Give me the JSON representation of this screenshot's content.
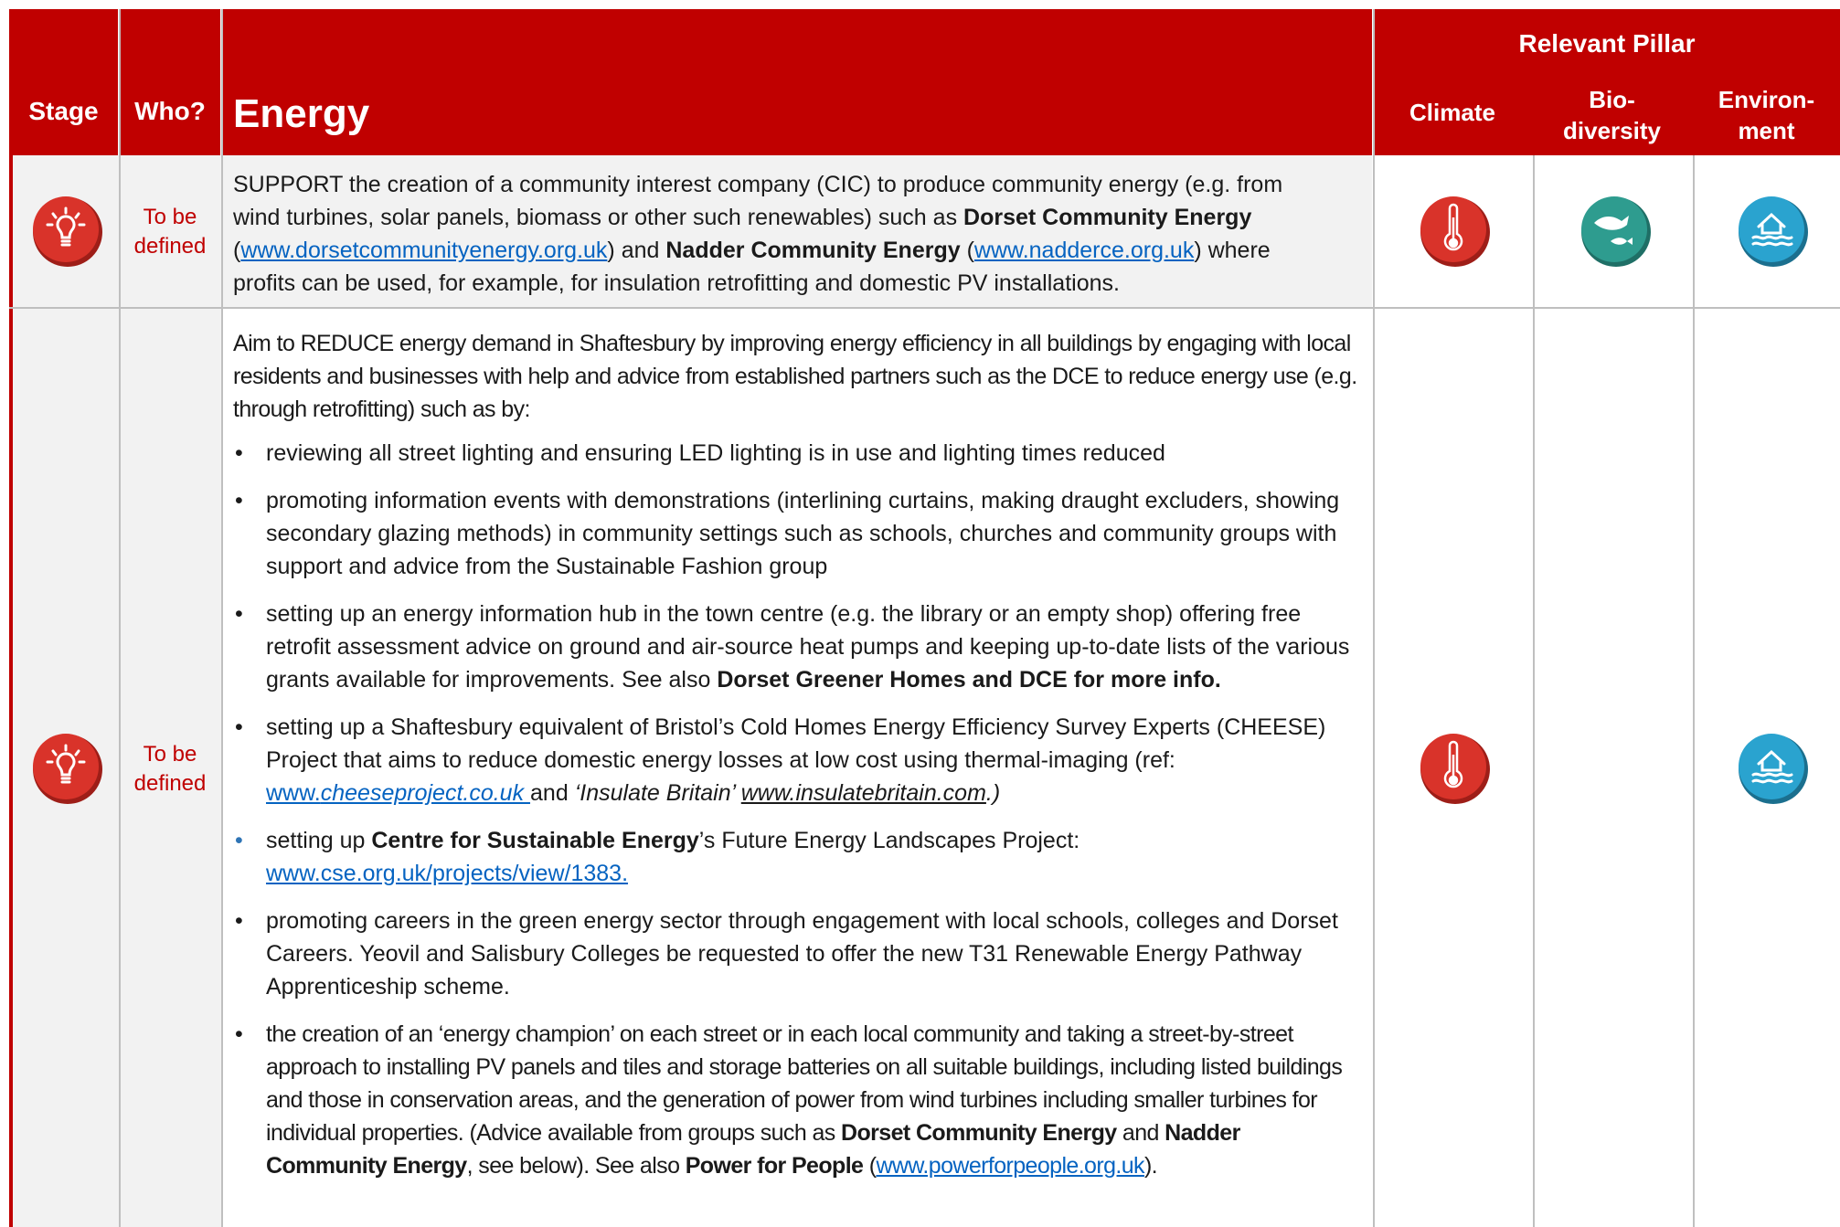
{
  "header": {
    "stage": "Stage",
    "who": "Who?",
    "topic": "Energy",
    "pillar_title": "Relevant Pillar",
    "pillars": {
      "climate": "Climate",
      "bio_l1": "Bio-",
      "bio_l2": "diversity",
      "env_l1": "Environ-",
      "env_l2": "ment"
    }
  },
  "colors": {
    "header_red": "#c00000",
    "climate_red": "#d9332a",
    "bio_teal": "#2e9c8f",
    "env_blue": "#2aa3cf",
    "link_blue": "#0563c1"
  },
  "icons": {
    "stage": "lightbulb-icon",
    "climate": "thermometer-icon",
    "bio": "whale-fish-icon",
    "env": "flooded-house-icon"
  },
  "row1": {
    "who_l1": "To be",
    "who_l2": "defined",
    "t1": "SUPPORT the creation of a community interest company (CIC) to produce community energy (e.g. from",
    "t2a": "wind turbines, solar panels, biomass or other such renewables) such as ",
    "t2b": "Dorset Community Energy",
    "t3a": "(",
    "t3link1": "www.dorsetcommunityenergy.org.uk",
    "t3b": ") and ",
    "t3bold": "Nadder Community Energy",
    "t3c": " (",
    "t3link2": "www.nadderce.org.uk",
    "t3d": ") where",
    "t4": "profits can be used, for example, for insulation retrofitting and domestic PV installations."
  },
  "row2": {
    "who_l1": "To be",
    "who_l2": "defined",
    "intro": "Aim to REDUCE energy demand in Shaftesbury by improving energy efficiency in all buildings by engaging with local residents and businesses with help and advice from established partners such as the DCE to reduce energy use (e.g. through retrofitting) such as by:",
    "b1": "reviewing all street lighting and ensuring LED lighting is in use and lighting times reduced",
    "b2": "promoting information events with demonstrations (interlining curtains, making draught excluders, showing secondary glazing methods) in community settings such as schools, churches and community groups with support and advice from the Sustainable Fashion group",
    "b3a": "setting up an energy information hub in the town centre (e.g. the library or an empty shop) offering free retrofit assessment advice on ground and air-source heat pumps and keeping up-to-date lists of the various grants available for improvements. See also ",
    "b3bold": "Dorset Greener Homes and DCE for more info.",
    "b4a": "setting up a Shaftesbury equivalent of Bristol’s Cold Homes Energy Efficiency Survey Experts (CHEESE) Project that aims to reduce domestic energy losses at low cost using thermal-imaging (ref: ",
    "b4link1a": "www.",
    "b4link1b": "cheeseproject.co.uk ",
    "b4b": "and ",
    "b4italic": "‘Insulate Britain’ ",
    "b4link2": "www.insulatebritain.com",
    "b4c": ".)",
    "b5a": "setting up ",
    "b5bold": "Centre for Sustainable Energy",
    "b5b": "’s Future Energy Landscapes Project: ",
    "b5link": "www.cse.org.uk/projects/view/1383.",
    "b6": "promoting careers in the green energy sector through engagement with local schools, colleges and Dorset Careers. Yeovil and Salisbury Colleges be requested to offer the new T31 Renewable Energy Pathway Apprenticeship scheme.",
    "b7a": "the creation of an ‘energy champion’ on each street or in each local community and taking a street-by-street approach to installing PV panels and tiles and storage batteries on all suitable buildings, including listed buildings and those in conservation areas, and the generation of power from wind turbines including smaller turbines for individual properties. (Advice available from groups such as ",
    "b7bold1": "Dorset Community Energy",
    "b7b": " and ",
    "b7bold2": "Nadder Community Energy",
    "b7c": ", see below). See also ",
    "b7bold3": "Power for People",
    "b7d": " (",
    "b7link": "www.powerforpeople.org.uk",
    "b7e": ")."
  }
}
